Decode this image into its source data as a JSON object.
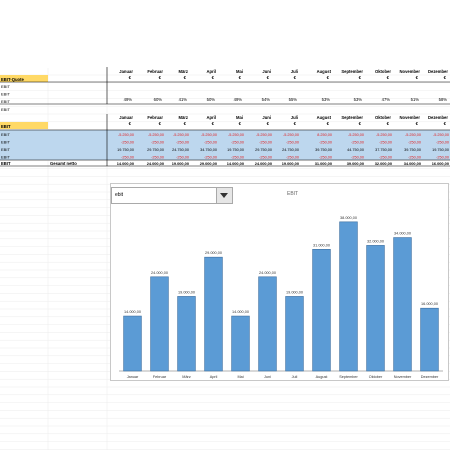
{
  "sheet": {
    "months": [
      "Januar",
      "Februar",
      "März",
      "April",
      "Mai",
      "Juni",
      "Juli",
      "August",
      "September",
      "Oktober",
      "November",
      "Dezember"
    ],
    "currency": "€",
    "quote_label": "EBIT-Quote",
    "row_labels_small": [
      "EBIT",
      "EBIT",
      "EBIT",
      "EBIT"
    ],
    "quote_percent": [
      "49%",
      "60%",
      "41%",
      "50%",
      "49%",
      "54%",
      "55%",
      "53%",
      "53%",
      "47%",
      "51%",
      "58%"
    ],
    "ebit_label": "EBIT",
    "ebit_rows": [
      {
        "label": "EBIT",
        "values": [
          "-5.250,00",
          "-5.250,00",
          "-5.250,00",
          "-5.250,00",
          "-5.250,00",
          "-5.250,00",
          "-5.250,00",
          "8.250,00",
          "-5.250,00",
          "-5.250,00",
          "-5.250,00",
          "-5.250,00"
        ],
        "red": true
      },
      {
        "label": "EBIT",
        "values": [
          "-250,00",
          "-250,00",
          "-250,00",
          "-250,00",
          "-250,00",
          "-250,00",
          "-250,00",
          "-250,00",
          "-250,00",
          "-250,00",
          "-250,00",
          "-250,00"
        ],
        "red": true
      },
      {
        "label": "EBIT",
        "values": [
          "19.750,00",
          "29.750,00",
          "24.750,00",
          "34.750,00",
          "19.750,00",
          "29.750,00",
          "24.750,00",
          "39.750,00",
          "44.750,00",
          "37.750,00",
          "39.750,00",
          "19.750,00"
        ],
        "red": false
      },
      {
        "label": "EBIT",
        "values": [
          "-250,00",
          "-250,00",
          "-250,00",
          "-250,00",
          "-250,00",
          "-250,00",
          "-250,00",
          "-250,00",
          "-250,00",
          "-250,00",
          "-250,00",
          "-250,00"
        ],
        "red": true
      }
    ],
    "total_label": "EBIT",
    "total_sub_label": "Gesamt netto",
    "totals": [
      "14.000,00",
      "24.000,00",
      "19.000,00",
      "29.000,00",
      "14.000,00",
      "24.000,00",
      "19.000,00",
      "31.000,00",
      "39.000,00",
      "32.000,00",
      "34.000,00",
      "16.000,00"
    ]
  },
  "chart": {
    "dropdown_value": "ebit",
    "title": "EBIT"
  },
  "colors": {
    "bar": "#5b9bd5",
    "bar_border": "#3c6e9f",
    "selection": "#bdd7ee",
    "header_yellow": "#ffd966",
    "negative": "#e02020"
  },
  "chart_data": {
    "type": "bar",
    "title": "EBIT",
    "categories": [
      "Januar",
      "Februar",
      "März",
      "April",
      "Mai",
      "Juni",
      "Juli",
      "August",
      "September",
      "Oktober",
      "November",
      "Dezember"
    ],
    "values": [
      14000,
      24000,
      19000,
      29000,
      14000,
      24000,
      19000,
      31000,
      38000,
      32000,
      34000,
      16000
    ],
    "data_labels": [
      "14.000,00",
      "24.000,00",
      "19.000,00",
      "29.000,00",
      "14.000,00",
      "24.000,00",
      "19.000,00",
      "31.000,00",
      "38.000,00",
      "32.000,00",
      "34.000,00",
      "16.000,00"
    ],
    "ylim": [
      0,
      40000
    ],
    "grid": false,
    "xlabel": "",
    "ylabel": ""
  }
}
